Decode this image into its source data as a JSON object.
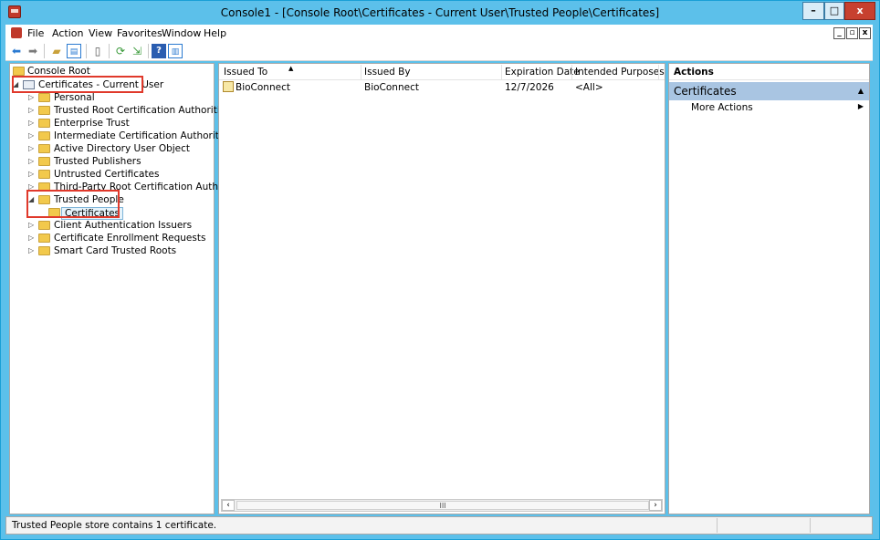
{
  "window": {
    "title": "Console1 - [Console Root\\Certificates - Current User\\Trusted People\\Certificates]",
    "controls": {
      "minimize": "–",
      "maximize": "□",
      "close": "x"
    }
  },
  "menubar": {
    "items": [
      "File",
      "Action",
      "View",
      "Favorites",
      "Window",
      "Help"
    ],
    "mdi_controls": [
      "_",
      "▫",
      "x"
    ]
  },
  "toolbar": {
    "icons": [
      "back-icon",
      "forward-icon",
      "up-folder-icon",
      "show-hide-tree-icon",
      "clipboard-icon",
      "refresh-icon",
      "export-icon",
      "help-icon",
      "action-pane-icon"
    ]
  },
  "tree": {
    "root": "Console Root",
    "store": "Certificates - Current User",
    "items": [
      {
        "label": "Personal",
        "expanded": false
      },
      {
        "label": "Trusted Root Certification Authorities",
        "expanded": false
      },
      {
        "label": "Enterprise Trust",
        "expanded": false
      },
      {
        "label": "Intermediate Certification Authorities",
        "expanded": false
      },
      {
        "label": "Active Directory User Object",
        "expanded": false
      },
      {
        "label": "Trusted Publishers",
        "expanded": false
      },
      {
        "label": "Untrusted Certificates",
        "expanded": false
      },
      {
        "label": "Third-Party Root Certification Authorities",
        "expanded": false
      },
      {
        "label": "Trusted People",
        "expanded": true
      },
      {
        "label": "Client Authentication Issuers",
        "expanded": false
      },
      {
        "label": "Certificate Enrollment Requests",
        "expanded": false
      },
      {
        "label": "Smart Card Trusted Roots",
        "expanded": false
      }
    ],
    "selected_child": "Certificates"
  },
  "list": {
    "columns": [
      "Issued To",
      "Issued By",
      "Expiration Date",
      "Intended Purposes"
    ],
    "rows": [
      {
        "issued_to": "BioConnect",
        "issued_by": "BioConnect",
        "expiration": "12/7/2026",
        "purposes": "<All>"
      }
    ],
    "scroll_thumb": "III"
  },
  "actions": {
    "title": "Actions",
    "section": "Certificates",
    "items": [
      "More Actions"
    ]
  },
  "status": {
    "text": "Trusted People store contains 1 certificate."
  },
  "colors": {
    "frame": "#5cc0ea",
    "highlight_box": "#e0392b",
    "actions_section": "#a9c5e2"
  }
}
